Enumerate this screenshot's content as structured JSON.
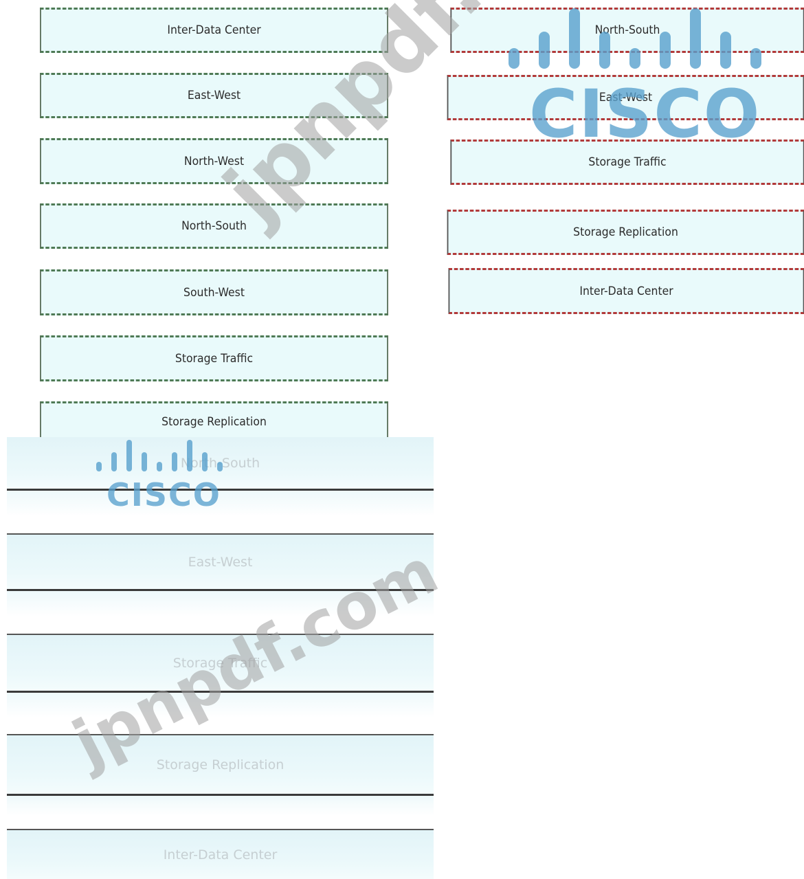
{
  "left_column": [
    "Inter-Data Center",
    "East-West",
    "North-West",
    "North-South",
    "South-West",
    "Storage Traffic",
    "Storage Replication"
  ],
  "right_column": [
    "North-South",
    "East-West",
    "Storage Traffic",
    "Storage Replication",
    "Inter-Data Center"
  ],
  "faded_column": [
    "North-South",
    "East-West",
    "Storage Traffic",
    "Storage Replication",
    "Inter-Data Center"
  ],
  "watermark": {
    "site_text": "jpnpdf.com",
    "logo_word": "CISCO"
  },
  "colors": {
    "box_fill": "#e9fafb",
    "left_dash": "#4f7a55",
    "right_dash": "#b23a3a",
    "logo_blue": "#58a0cd"
  }
}
